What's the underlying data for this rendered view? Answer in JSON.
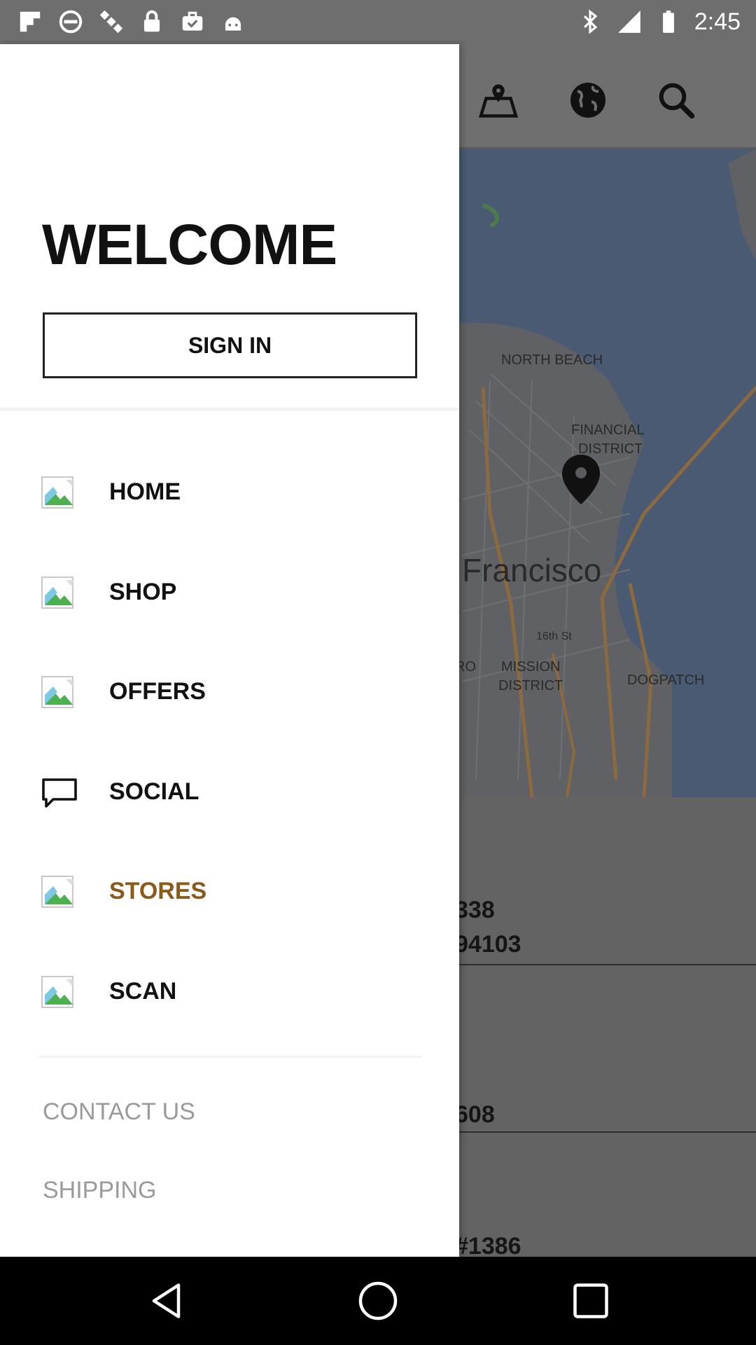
{
  "status_bar": {
    "time": "2:45",
    "left_icons": [
      "flipboard-icon",
      "blocked-icon",
      "satellite-icon",
      "lock-icon",
      "briefcase-icon",
      "android-icon"
    ],
    "right_icons": [
      "bluetooth-icon",
      "signal-icon",
      "battery-icon"
    ]
  },
  "background_app": {
    "toolbar_icons": [
      "map-icon",
      "globe-icon",
      "search-icon"
    ],
    "map": {
      "labels": {
        "north_beach": "NORTH BEACH",
        "financial": "FINANCIAL",
        "district": "DISTRICT",
        "city": "Francisco",
        "street": "16th St",
        "mission": "MISSION",
        "mission_district": "DISTRICT",
        "dogpatch": "DOGPATCH",
        "partial_ro": "RO"
      }
    },
    "store_list": [
      {
        "line1": "338",
        "line2": "94103"
      },
      {
        "line1": "608"
      },
      {
        "line1": "#1386"
      }
    ]
  },
  "drawer": {
    "welcome": "WELCOME",
    "sign_in_label": "SIGN IN",
    "menu": [
      {
        "label": "HOME",
        "icon": "image-placeholder-icon",
        "active": false
      },
      {
        "label": "SHOP",
        "icon": "image-placeholder-icon",
        "active": false
      },
      {
        "label": "OFFERS",
        "icon": "image-placeholder-icon",
        "active": false
      },
      {
        "label": "SOCIAL",
        "icon": "chat-bubble-icon",
        "active": false
      },
      {
        "label": "STORES",
        "icon": "image-placeholder-icon",
        "active": true
      },
      {
        "label": "SCAN",
        "icon": "image-placeholder-icon",
        "active": false
      }
    ],
    "secondary_links": [
      "CONTACT US",
      "SHIPPING"
    ]
  },
  "nav_bar": {
    "buttons": [
      "back-icon",
      "home-icon",
      "recents-icon"
    ]
  },
  "colors": {
    "active_item": "#8b5a1b",
    "secondary_link": "#9a9a9a",
    "scrim": "#616161"
  }
}
